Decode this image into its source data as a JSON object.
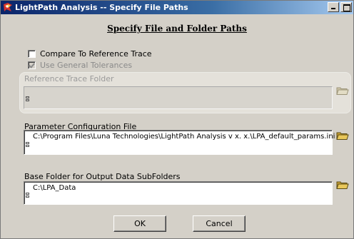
{
  "window": {
    "title": "LightPath Analysis -- Specify File Paths",
    "icon": "lightpath-app-icon"
  },
  "heading": "Specify File and Folder Paths",
  "options": {
    "compare_reference": {
      "label": "Compare To Reference Trace",
      "checked": false,
      "enabled": true
    },
    "general_tolerances": {
      "label": "Use General Tolerances",
      "checked": true,
      "enabled": false
    }
  },
  "reference_trace": {
    "label": "Reference Trace Folder",
    "value": "",
    "enabled": false
  },
  "parameter_file": {
    "label": "Parameter Configuration File",
    "value": "C:\\Program Files\\Luna Technologies\\LightPath Analysis v x. x.\\LPA_default_params.ini"
  },
  "base_folder": {
    "label": "Base Folder for Output Data SubFolders",
    "value": "C:\\LPA_Data"
  },
  "buttons": {
    "ok": "OK",
    "cancel": "Cancel"
  },
  "icons": {
    "browse": "open-folder-icon",
    "path_browse_glyph": "browse-path-icon"
  },
  "colors": {
    "title_gradient_start": "#0a246a",
    "title_gradient_end": "#a6caf0",
    "dialog_bg": "#d4d0c8",
    "folder_yellow": "#e8c75a"
  }
}
